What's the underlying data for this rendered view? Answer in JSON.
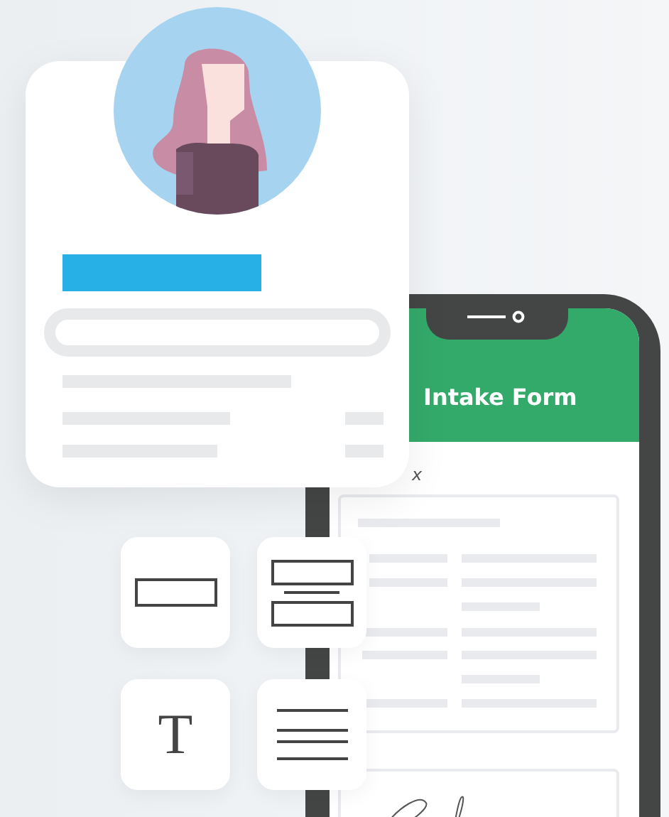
{
  "phone": {
    "title": "Intake Form",
    "signature_mark": "x"
  },
  "tools": [
    {
      "kind": "field"
    },
    {
      "kind": "form"
    },
    {
      "kind": "text",
      "label": "T"
    },
    {
      "kind": "paragraph"
    }
  ]
}
